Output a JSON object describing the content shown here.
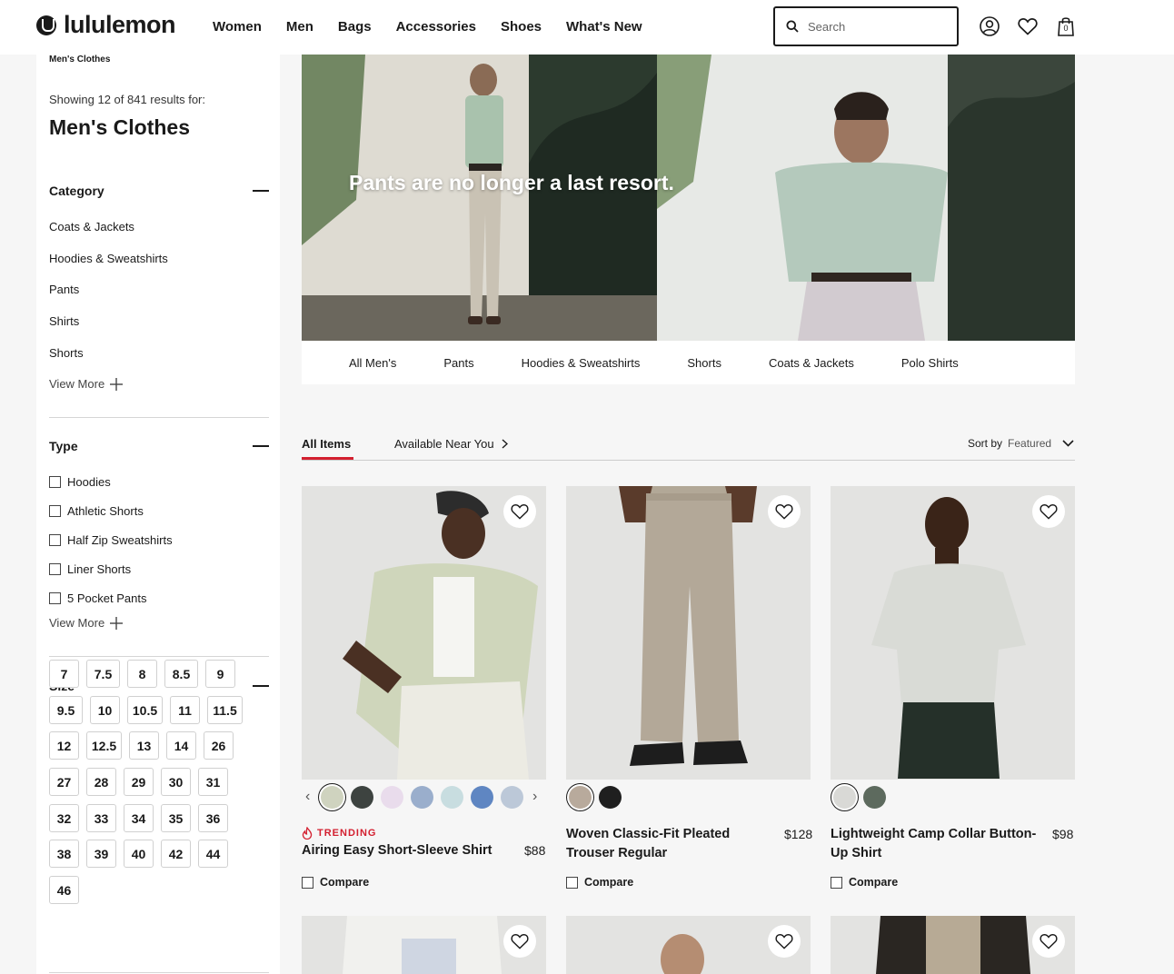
{
  "header": {
    "logo": "lululemon",
    "nav": [
      "Women",
      "Men",
      "Bags",
      "Accessories",
      "Shoes",
      "What's New"
    ],
    "search_placeholder": "Search",
    "bag_count": "0"
  },
  "sidebar": {
    "breadcrumb": "Men's Clothes",
    "results_text": "Showing 12 of 841 results for:",
    "title": "Men's Clothes",
    "category": {
      "heading": "Category",
      "items": [
        "Coats & Jackets",
        "Hoodies & Sweatshirts",
        "Pants",
        "Shirts",
        "Shorts"
      ],
      "view_more": "View More"
    },
    "type": {
      "heading": "Type",
      "items": [
        "Hoodies",
        "Athletic Shorts",
        "Half Zip Sweatshirts",
        "Liner Shorts",
        "5 Pocket Pants"
      ],
      "view_more": "View More"
    },
    "size": {
      "heading": "Size",
      "rows": [
        [
          "7",
          "7.5",
          "8",
          "8.5",
          "9"
        ],
        [
          "9.5",
          "10",
          "10.5",
          "11",
          "11.5"
        ],
        [
          "12",
          "12.5",
          "13",
          "14",
          "26"
        ],
        [
          "27",
          "28",
          "29",
          "30",
          "31"
        ],
        [
          "32",
          "33",
          "34",
          "35",
          "36"
        ],
        [
          "38",
          "39",
          "40",
          "42",
          "44"
        ],
        [
          "46"
        ]
      ]
    }
  },
  "banner": {
    "tagline": "Pants are no longer a last resort."
  },
  "subnav": [
    "All Men's",
    "Pants",
    "Hoodies & Sweatshirts",
    "Shorts",
    "Coats & Jackets",
    "Polo Shirts"
  ],
  "tabs": {
    "all_items": "All Items",
    "near_you": "Available Near You"
  },
  "sort": {
    "label": "Sort by",
    "value": "Featured"
  },
  "products": [
    {
      "badge": "TRENDING",
      "name": "Airing Easy Short-Sleeve Shirt",
      "price": "$88",
      "compare": "Compare",
      "swatches": [
        "#cfd3bf",
        "#3d4340",
        "#e9dcec",
        "#9aaecc",
        "#c8dde0",
        "#5f86c2",
        "#bcc8d8"
      ]
    },
    {
      "badge": "",
      "name": "Woven Classic-Fit Pleated Trouser Regular",
      "price": "$128",
      "compare": "Compare",
      "swatches": [
        "#b8aa9c",
        "#1f1f1f"
      ]
    },
    {
      "badge": "",
      "name": "Lightweight Camp Collar Button-Up Shirt",
      "price": "$98",
      "compare": "Compare",
      "swatches": [
        "#d9d9d6",
        "#5d6a5e"
      ]
    }
  ],
  "colors": {
    "accent": "#d31f2f",
    "text": "#1a1a1a"
  }
}
